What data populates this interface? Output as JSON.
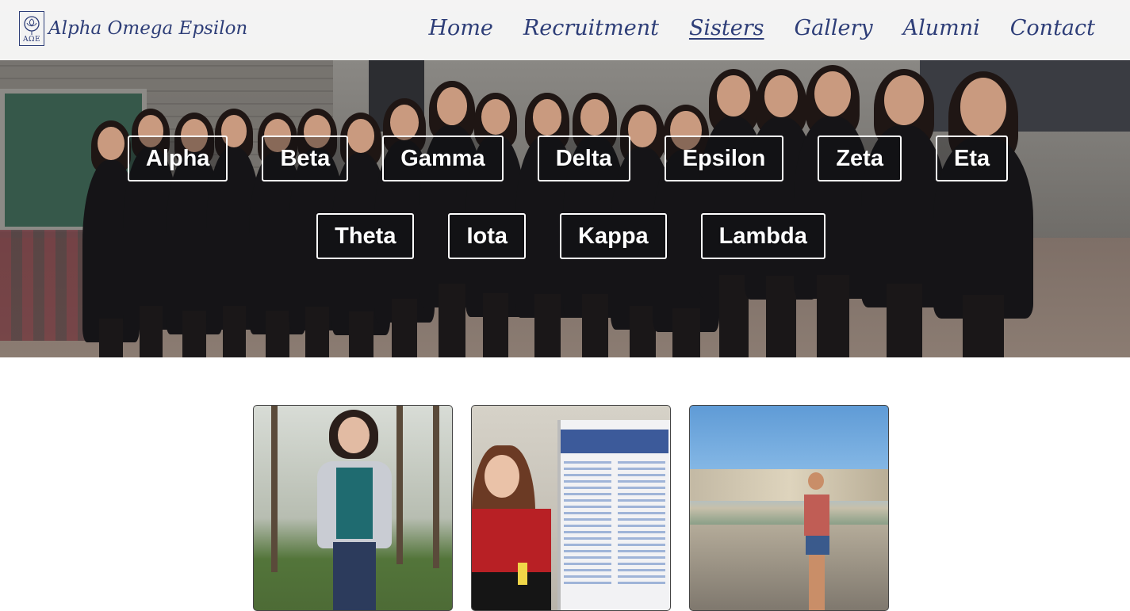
{
  "brand": {
    "name": "Alpha Omega Epsilon",
    "logo_letters": "AΩE",
    "logo_icon": "rose-icon",
    "color": "#2e3e78"
  },
  "nav": {
    "items": [
      {
        "label": "Home",
        "active": false
      },
      {
        "label": "Recruitment",
        "active": false
      },
      {
        "label": "Sisters",
        "active": true
      },
      {
        "label": "Gallery",
        "active": false
      },
      {
        "label": "Alumni",
        "active": false
      },
      {
        "label": "Contact",
        "active": false
      }
    ]
  },
  "classes": {
    "row1": [
      "Alpha",
      "Beta",
      "Gamma",
      "Delta",
      "Epsilon",
      "Zeta",
      "Eta"
    ],
    "row2": [
      "Theta",
      "Iota",
      "Kappa",
      "Lambda"
    ]
  },
  "sister_cards": [
    {
      "image": "sister-photo-outdoor"
    },
    {
      "image": "sister-photo-poster"
    },
    {
      "image": "sister-photo-river"
    }
  ]
}
